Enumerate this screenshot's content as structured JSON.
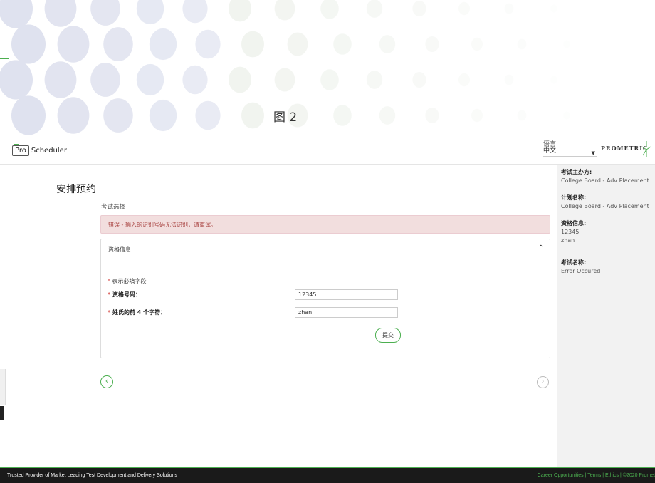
{
  "banner": {
    "caption": "图 2"
  },
  "header": {
    "logo_pro": "Pro",
    "logo_scheduler": "Scheduler",
    "language_label": "语言",
    "language_value": "中文",
    "brand": "PROMETRIC"
  },
  "main": {
    "page_title": "安排预约",
    "section_label": "考试选择",
    "error_message": "错误 - 输入的识别号码无法识别，请重试。",
    "panel": {
      "title": "资格信息",
      "required_note": "表示必填字段",
      "fields": [
        {
          "label": "资格号码：",
          "value": "12345"
        },
        {
          "label": "姓氏的前 4 个字符：",
          "value": "zhan"
        }
      ],
      "submit_label": "提交"
    }
  },
  "sidebar": {
    "sponsor_title": "考试主办方:",
    "sponsor_value": "College Board - Adv Placement",
    "program_title": "计划名称:",
    "program_value": "College Board - Adv Placement",
    "eligibility_title": "资格信息:",
    "eligibility_id": "12345",
    "eligibility_name": "zhan",
    "exam_title": "考试名称:",
    "exam_value": "Error Occured"
  },
  "footer": {
    "tagline": "Trusted Provider of Market Leading Test Development and Delivery Solutions",
    "links": "Career Opportunities | Terms | Ethics | ©2020 Promet"
  },
  "colors": {
    "accent": "#4caf50",
    "error_bg": "#f2dede",
    "error_text": "#a94442",
    "sidebar_bg": "#f2f2f2",
    "footer_bg": "#1a1a1a"
  }
}
